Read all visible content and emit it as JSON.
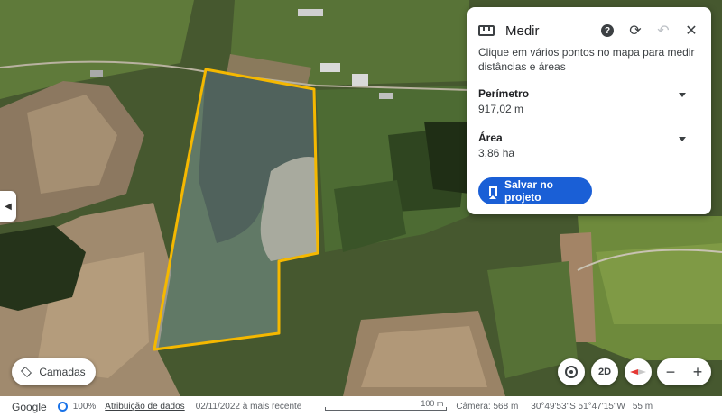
{
  "map": {
    "measure_color": "#f5b800",
    "fill_color": "#8fb0c0"
  },
  "panel": {
    "title": "Medir",
    "help_icon": "help-icon",
    "redo_icon": "refresh-icon",
    "undo_icon": "undo-icon",
    "close_icon": "close-icon",
    "description": "Clique em vários pontos no mapa para medir distâncias e áreas",
    "perimeter_label": "Perímetro",
    "perimeter_value": "917,02 m",
    "area_label": "Área",
    "area_value": "3,86 ha",
    "save_label": "Salvar no projeto",
    "save_color": "#1a5fd6"
  },
  "controls": {
    "layers_label": "Camadas",
    "mode_label": "2D",
    "zoom_out": "−",
    "zoom_in": "+"
  },
  "status": {
    "brand": "Google",
    "progress": "100%",
    "attribution": "Atribuição de dados",
    "date": "02/11/2022 à mais recente",
    "scale": "100 m",
    "camera": "Câmera: 568 m",
    "coords": "30°49'53\"S 51°47'15\"W",
    "altitude": "55 m"
  }
}
